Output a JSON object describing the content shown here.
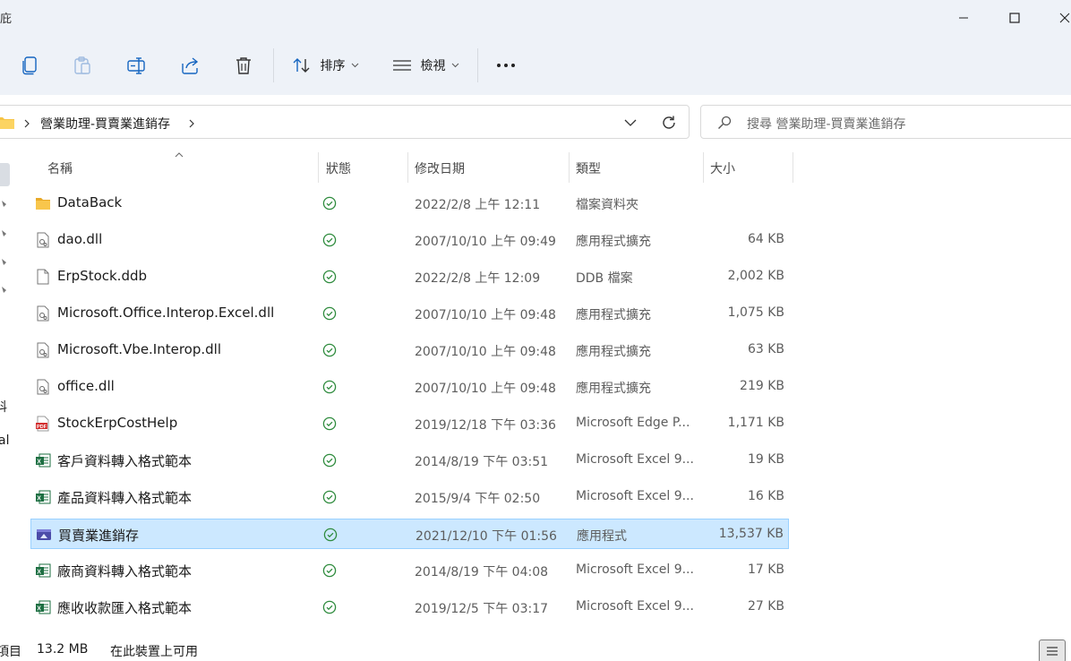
{
  "window": {
    "title_fragment": "庇",
    "controls": [
      "minimize-icon",
      "maximize-icon",
      "close-icon"
    ]
  },
  "toolbar": {
    "icons": [
      "copy-icon",
      "paste-icon",
      "rename-icon",
      "share-icon",
      "delete-icon"
    ],
    "sort_label": "排序",
    "view_label": "檢視",
    "more_icon": "more-icon"
  },
  "address": {
    "folder_icon": "folder-icon",
    "breadcrumb": "營業助理-買賣業進銷存"
  },
  "search": {
    "placeholder": "搜尋 營業助理-買賣業進銷存"
  },
  "nav": {
    "fragment_1": "科",
    "fragment_2": "al"
  },
  "columns": {
    "name": "名稱",
    "status": "狀態",
    "modified": "修改日期",
    "type": "類型",
    "size": "大小"
  },
  "files": [
    {
      "name": "DataBack",
      "date": "2022/2/8 上午 12:11",
      "type": "檔案資料夾",
      "size": "",
      "icon": "folder"
    },
    {
      "name": "dao.dll",
      "date": "2007/10/10 上午 09:49",
      "type": "應用程式擴充",
      "size": "64 KB",
      "icon": "dll"
    },
    {
      "name": "ErpStock.ddb",
      "date": "2022/2/8 上午 12:09",
      "type": "DDB 檔案",
      "size": "2,002 KB",
      "icon": "file"
    },
    {
      "name": "Microsoft.Office.Interop.Excel.dll",
      "date": "2007/10/10 上午 09:48",
      "type": "應用程式擴充",
      "size": "1,075 KB",
      "icon": "dll"
    },
    {
      "name": "Microsoft.Vbe.Interop.dll",
      "date": "2007/10/10 上午 09:48",
      "type": "應用程式擴充",
      "size": "63 KB",
      "icon": "dll"
    },
    {
      "name": "office.dll",
      "date": "2007/10/10 上午 09:48",
      "type": "應用程式擴充",
      "size": "219 KB",
      "icon": "dll"
    },
    {
      "name": "StockErpCostHelp",
      "date": "2019/12/18 下午 03:36",
      "type": "Microsoft Edge P...",
      "size": "1,171 KB",
      "icon": "pdf"
    },
    {
      "name": "客戶資料轉入格式範本",
      "date": "2014/8/19 下午 03:51",
      "type": "Microsoft Excel 9...",
      "size": "19 KB",
      "icon": "excel"
    },
    {
      "name": "產品資料轉入格式範本",
      "date": "2015/9/4 下午 02:50",
      "type": "Microsoft Excel 9...",
      "size": "16 KB",
      "icon": "excel"
    },
    {
      "name": "買賣業進銷存",
      "date": "2021/12/10 下午 01:56",
      "type": "應用程式",
      "size": "13,537 KB",
      "icon": "app",
      "selected": true
    },
    {
      "name": "廠商資料轉入格式範本",
      "date": "2014/8/19 下午 04:08",
      "type": "Microsoft Excel 9...",
      "size": "17 KB",
      "icon": "excel"
    },
    {
      "name": "應收收款匯入格式範本",
      "date": "2019/12/5 下午 03:17",
      "type": "Microsoft Excel 9...",
      "size": "27 KB",
      "icon": "excel"
    }
  ],
  "status_bar": {
    "items_fragment": "項目",
    "size": "13.2 MB",
    "availability": "在此裝置上可用"
  },
  "colors": {
    "chrome_bg": "#eef2f8",
    "selection_bg": "#cce8ff",
    "selection_border": "#99d1ff",
    "status_ok": "#2e8b3d",
    "folder": "#f6c445"
  }
}
